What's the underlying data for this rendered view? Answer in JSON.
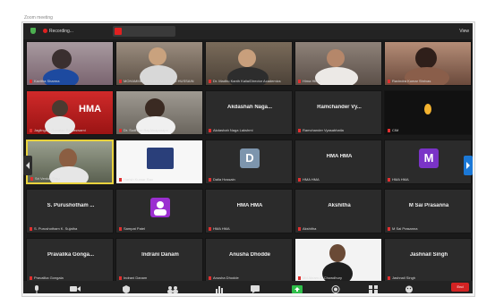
{
  "caption": "Zoom meeting",
  "topbar": {
    "recording_label": "Recording...",
    "view_label": "View"
  },
  "tiles": [
    {
      "kind": "photo",
      "caption": "Kavitha Sharma",
      "scene": "pink-bg"
    },
    {
      "kind": "photo",
      "caption": "MOHAMMED HYDER ALI MOHD HUSSAIN",
      "scene": "office"
    },
    {
      "kind": "photo",
      "caption": "Dr. Madhu Kanth Kalia/Director Academics",
      "scene": "room"
    },
    {
      "kind": "photo",
      "caption": "Hima Hima",
      "scene": "room2"
    },
    {
      "kind": "photo",
      "caption": "Ravindra Kumar Shrivas",
      "scene": "outdoor"
    },
    {
      "kind": "photo",
      "caption": "Jaglingam Gunalan Ramaswami",
      "scene": "red-hma",
      "brand": "HMA"
    },
    {
      "kind": "photo",
      "caption": "Dr. Sudheer Raj Ainapurapu",
      "scene": "books"
    },
    {
      "kind": "name",
      "label": "Akdashah Naga...",
      "caption": "Akdashah Naga Lakshmi"
    },
    {
      "kind": "name",
      "label": "Ramchander Vy...",
      "caption": "Ramchander Vyasabhatla"
    },
    {
      "kind": "photo",
      "caption": "CIM",
      "scene": "candle"
    },
    {
      "kind": "photo",
      "caption": "Sri Venkat Raju",
      "scene": "person-green",
      "active": true
    },
    {
      "kind": "photo",
      "caption": "Harish Kumar Rao",
      "scene": "logo"
    },
    {
      "kind": "letter",
      "letter": "D",
      "color": "#7d95ad",
      "caption": "Dalia Hossain"
    },
    {
      "kind": "name",
      "label": "HMA HMA",
      "caption": "HMA HMA"
    },
    {
      "kind": "letter",
      "letter": "M",
      "color": "#7a33c7",
      "caption": "HMA HMA"
    },
    {
      "kind": "name",
      "label": "S. Purushotham ...",
      "caption": "S. Purushotham K. Sujatha"
    },
    {
      "kind": "usericon",
      "caption": "Sampat Patel"
    },
    {
      "kind": "name",
      "label": "HMA HMA",
      "caption": "HMA HMA"
    },
    {
      "kind": "name",
      "label": "Akshitha",
      "caption": "Akshitha"
    },
    {
      "kind": "name",
      "label": "M Sai Prasanna",
      "caption": "M Sai Prasanna"
    },
    {
      "kind": "name",
      "label": "Pravalika Gonga...",
      "caption": "Pravalika Gongala"
    },
    {
      "kind": "name",
      "label": "Indrani Danam",
      "caption": "Indrani Danam"
    },
    {
      "kind": "name",
      "label": "Anusha Dhodde",
      "caption": "Anusha Dhodde"
    },
    {
      "kind": "photo",
      "caption": "Md Akram A. Chowdhury",
      "scene": "person-white"
    },
    {
      "kind": "name",
      "label": "Jashnail Singh",
      "caption": "Jashnail Singh"
    }
  ],
  "toolbar": {
    "end_label": "End"
  }
}
